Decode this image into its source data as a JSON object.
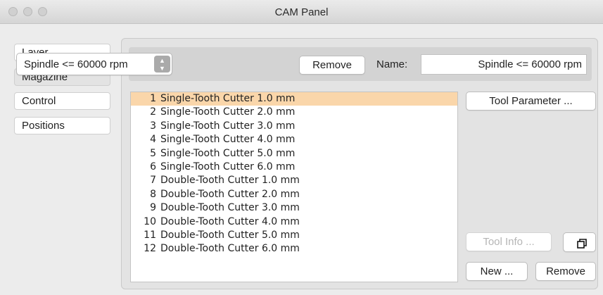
{
  "window": {
    "title": "CAM Panel"
  },
  "sidebar": {
    "tabs": [
      {
        "label": "Layer"
      },
      {
        "label": "Magazine"
      },
      {
        "label": "Control"
      },
      {
        "label": "Positions"
      }
    ]
  },
  "spindle": {
    "selected": "Spindle <= 60000 rpm",
    "remove_label": "Remove",
    "name_label": "Name:",
    "name_value": "Spindle <= 60000 rpm"
  },
  "tools": [
    {
      "num": "1",
      "name": "Single-Tooth Cutter 1.0 mm"
    },
    {
      "num": "2",
      "name": "Single-Tooth Cutter 2.0 mm"
    },
    {
      "num": "3",
      "name": "Single-Tooth Cutter 3.0 mm"
    },
    {
      "num": "4",
      "name": "Single-Tooth Cutter 4.0 mm"
    },
    {
      "num": "5",
      "name": "Single-Tooth Cutter 5.0 mm"
    },
    {
      "num": "6",
      "name": "Single-Tooth Cutter 6.0 mm"
    },
    {
      "num": "7",
      "name": "Double-Tooth Cutter 1.0 mm"
    },
    {
      "num": "8",
      "name": "Double-Tooth Cutter 2.0 mm"
    },
    {
      "num": "9",
      "name": "Double-Tooth Cutter 3.0 mm"
    },
    {
      "num": "10",
      "name": "Double-Tooth Cutter 4.0 mm"
    },
    {
      "num": "11",
      "name": "Double-Tooth Cutter 5.0 mm"
    },
    {
      "num": "12",
      "name": "Double-Tooth Cutter 6.0 mm"
    }
  ],
  "buttons": {
    "tool_parameter": "Tool Parameter ...",
    "tool_info": "Tool Info ...",
    "new": "New ...",
    "remove": "Remove"
  },
  "colors": {
    "selection": "#fad6aa",
    "panel": "#e3e3e3",
    "window": "#ececec"
  }
}
